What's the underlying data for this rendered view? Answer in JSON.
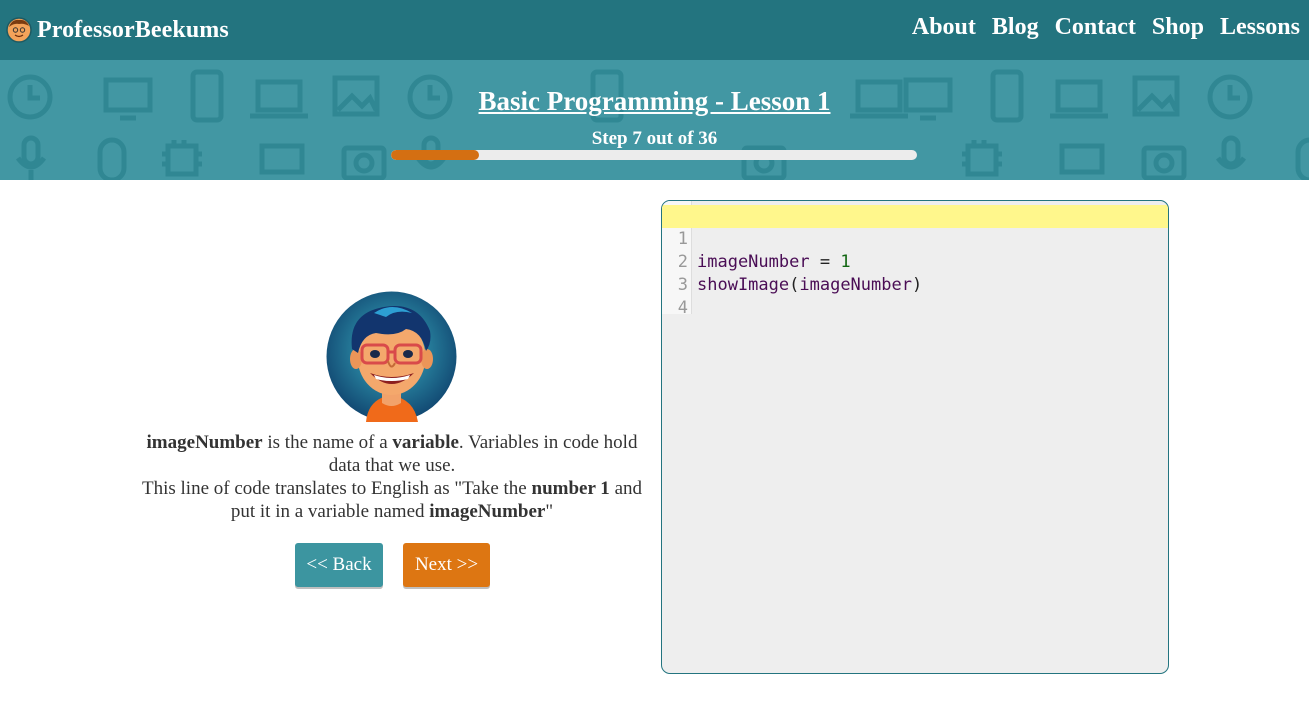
{
  "header": {
    "brand": "ProfessorBeekums",
    "nav": [
      "About",
      "Blog",
      "Contact",
      "Shop",
      "Lessons"
    ]
  },
  "lesson": {
    "title": "Basic Programming - Lesson 1",
    "step_text": "Step 7 out of 36",
    "progress_fraction": 0.1667
  },
  "explanation": {
    "p1_bold1": "imageNumber",
    "p1_text1": " is the name of a ",
    "p1_bold2": "variable",
    "p1_text2": ". Variables in code hold data that we use.",
    "p2_text1": "This line of code translates to English as \"Take the ",
    "p2_bold1": "number 1",
    "p2_text2": " and put it in a variable named ",
    "p2_bold2": "imageNumber",
    "p2_text3": "\""
  },
  "buttons": {
    "back": "<< Back",
    "next": "Next >>"
  },
  "editor": {
    "line_numbers": [
      "1",
      "2",
      "3",
      "4"
    ],
    "line1": {
      "var": "imageNumber",
      "op": " = ",
      "value": "1"
    },
    "line2": {
      "fn": "showImage",
      "open": "(",
      "arg": "imageNumber",
      "close": ")"
    }
  },
  "colors": {
    "header_bg": "#23747f",
    "banner_bg": "#4297a3",
    "progress": "#d46f12",
    "back_button": "#3c95a0",
    "next_button": "#dd7612",
    "active_line": "#fff78c"
  },
  "icons": {
    "brand_logo": "professor-face-icon",
    "banner_pattern": [
      "clock-icon",
      "monitor-icon",
      "phone-icon",
      "laptop-icon",
      "image-icon",
      "microphone-icon",
      "mouse-icon",
      "chip-icon",
      "camera-icon"
    ]
  }
}
